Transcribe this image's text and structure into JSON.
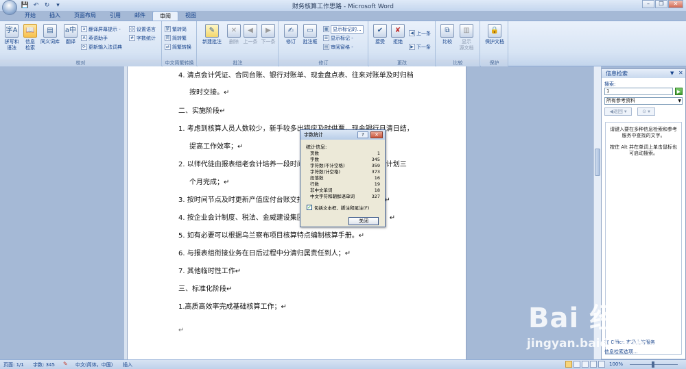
{
  "window": {
    "title": "财务核算工作思路 - Microsoft Word"
  },
  "qat": {
    "save": "💾",
    "undo": "↶",
    "redo": "↻",
    "more": "▾"
  },
  "winctrl": {
    "minimize": "–",
    "restore": "❐",
    "close": "✕"
  },
  "tabs": [
    "开始",
    "插入",
    "页面布局",
    "引用",
    "邮件",
    "审阅",
    "视图"
  ],
  "ribbon": {
    "proofing": {
      "label": "校对",
      "spell": "拼写和\n语法",
      "research": "信息\n检索",
      "thesaurus": "同义词库",
      "translate": "翻译",
      "tooltip": "翻译屏幕提示 -",
      "language": "设置语言",
      "english": "英语助手",
      "wordcount": "字数统计",
      "update": "更新输入法词典"
    },
    "chinese": {
      "label": "中文简繁转换",
      "tosimp": "繁转简",
      "totrad": "简转繁",
      "convert": "简繁转换"
    },
    "comments": {
      "label": "批注",
      "new": "新建批注",
      "delete": "删除",
      "prev": "上一条",
      "next": "下一条"
    },
    "tracking": {
      "label": "修订",
      "track": "修订",
      "balloons": "批注框",
      "show_markup_dd": "显示标记的...",
      "show_markup": "显示标记 -",
      "review_pane": "审阅窗格 -"
    },
    "changes": {
      "label": "更改",
      "accept": "接受",
      "reject": "拒绝",
      "prev": "上一条",
      "next": "下一条"
    },
    "compare": {
      "label": "比较",
      "compare": "比较",
      "show_source": "显示\n源文档"
    },
    "protect": {
      "label": "保护",
      "protect_doc": "保护文档"
    }
  },
  "document": {
    "lines": [
      "4.  清点会计凭证、合同台账、银行对账单、现金盘点表、往来对账单及时归档",
      "按时交接。↵",
      "二、实施阶段↵",
      "1.  考虑到核算人员人数较少，新手较多出错应及时供票，现金银行日清日结，",
      "提高工作效率；↵",
      "2.  以师代徒由报表组老会计培养一段时间，使新会计掌握核算技能，计划三",
      "个月完成；↵",
      "3.  按时间节点及时更新产值应付台账交报表组（每月25日前更新）；↵",
      "4.  按企业会计制度、税法、金威建设集团会计核算管理办法（细化）；↵",
      "5.  如有必要可以根据乌兰察布项目核算特点编制核算手册。↵",
      "6.  与报表组衔接业务在日后过程中分清归属责任到人；↵",
      "7.  其他临时性工作↵",
      "三、标准化阶段↵",
      "1.高质高效率完成基础核算工作；↵",
      "↵"
    ]
  },
  "dialog": {
    "title": "字数统计",
    "help": "?",
    "close_x": "✕",
    "group_label": "统计信息:",
    "stats": [
      {
        "label": "页数",
        "value": "1"
      },
      {
        "label": "字数",
        "value": "345"
      },
      {
        "label": "字符数(不计空格)",
        "value": "359"
      },
      {
        "label": "字符数(计空格)",
        "value": "373"
      },
      {
        "label": "段落数",
        "value": "16"
      },
      {
        "label": "行数",
        "value": "19"
      },
      {
        "label": "非中文单词",
        "value": "18"
      },
      {
        "label": "中文字符和朝鲜语单词",
        "value": "327"
      }
    ],
    "checkbox_label": "包括文本框、脚注和尾注(F)",
    "close_button": "关闭"
  },
  "pane": {
    "title": "信息检索",
    "search_label": "搜索:",
    "search_value": "1",
    "go": "▶",
    "source": "所有参考资料",
    "back": "◀返回 ▾",
    "forward": "⊙ ▾",
    "message1": "请键入要在多种信息检索和参考服务中查找的文字。",
    "message2": "按住 Alt 并在单词上单击鼠标也可启动搜索。",
    "bottom1": "在 Office 市场上的服务",
    "bottom2": "信息检索选项..."
  },
  "status": {
    "page": "页面: 1/1",
    "words": "字数: 345",
    "lang": "中文(简体，中国)",
    "insert": "插入",
    "zoom": "100%"
  },
  "watermark": {
    "brand": "Bai 经验",
    "url": "jingyan.baidu.com"
  }
}
